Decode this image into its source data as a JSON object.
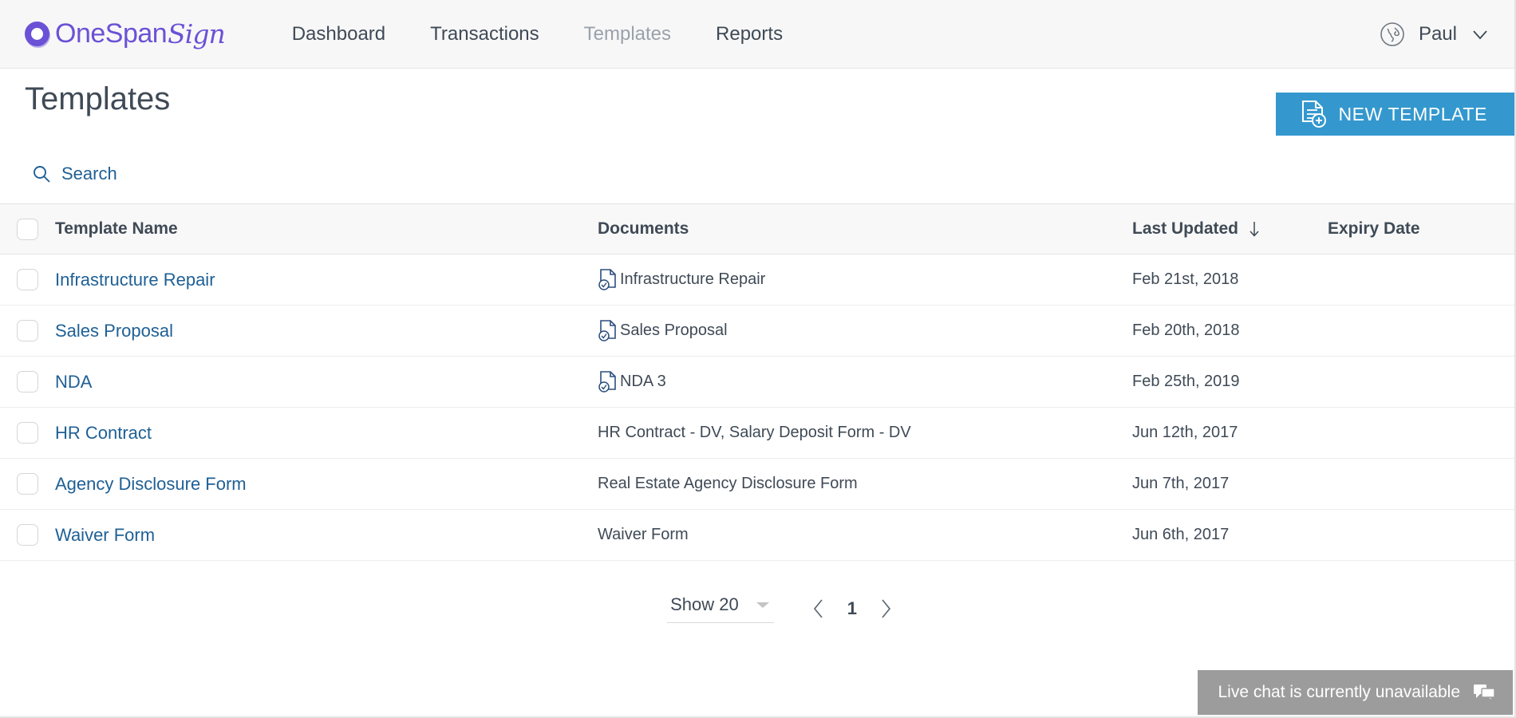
{
  "brand": {
    "name_primary": "OneSpan",
    "name_secondary": "Sign",
    "logo_icon": "onespan-ring-icon",
    "color": "#6b51d6"
  },
  "nav": {
    "links": [
      {
        "label": "Dashboard",
        "active": false
      },
      {
        "label": "Transactions",
        "active": false
      },
      {
        "label": "Templates",
        "active": true
      },
      {
        "label": "Reports",
        "active": false
      }
    ],
    "language_icon": "globe-icon",
    "user": "Paul",
    "user_caret_icon": "chevron-down-icon"
  },
  "header": {
    "title": "Templates",
    "new_template_label": "NEW TEMPLATE",
    "new_template_icon": "document-add-icon",
    "accent_color": "#3498ce"
  },
  "search": {
    "label": "Search",
    "icon": "search-icon"
  },
  "table": {
    "columns": {
      "name": "Template Name",
      "documents": "Documents",
      "last_updated": "Last Updated",
      "expiry": "Expiry Date"
    },
    "sort": {
      "column": "Last Updated",
      "direction": "down",
      "icon": "arrow-down-icon"
    },
    "rows": [
      {
        "name": "Infrastructure Repair",
        "documents": "Infrastructure Repair",
        "has_doc_icon": true,
        "last_updated": "Feb 21st, 2018",
        "expiry": ""
      },
      {
        "name": "Sales Proposal",
        "documents": "Sales Proposal",
        "has_doc_icon": true,
        "last_updated": "Feb 20th, 2018",
        "expiry": ""
      },
      {
        "name": "NDA",
        "documents": "NDA 3",
        "has_doc_icon": true,
        "last_updated": "Feb 25th, 2019",
        "expiry": ""
      },
      {
        "name": "HR Contract",
        "documents": "HR Contract - DV, Salary Deposit Form - DV",
        "has_doc_icon": false,
        "last_updated": "Jun 12th, 2017",
        "expiry": ""
      },
      {
        "name": "Agency Disclosure Form",
        "documents": "Real Estate Agency Disclosure Form",
        "has_doc_icon": false,
        "last_updated": "Jun 7th, 2017",
        "expiry": ""
      },
      {
        "name": "Waiver Form",
        "documents": "Waiver Form",
        "has_doc_icon": false,
        "last_updated": "Jun 6th, 2017",
        "expiry": ""
      }
    ]
  },
  "pagination": {
    "show_label": "Show 20",
    "current_page": "1",
    "prev_icon": "chevron-left-icon",
    "next_icon": "chevron-right-icon",
    "caret_icon": "caret-down-icon"
  },
  "chat": {
    "message": "Live chat is currently unavailable",
    "icon": "chat-bubble-icon"
  }
}
